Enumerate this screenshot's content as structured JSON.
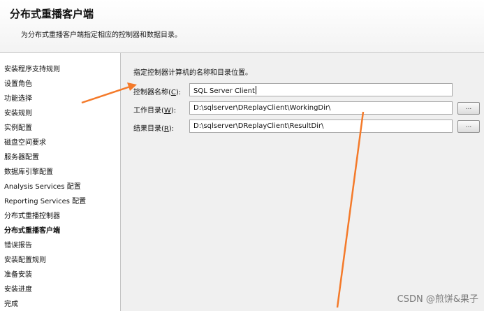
{
  "header": {
    "title": "分布式重播客户端",
    "subtitle": "为分布式重播客户端指定相应的控制器和数据目录。"
  },
  "sidebar": {
    "items": [
      {
        "label": "安装程序支持规则"
      },
      {
        "label": "设置角色"
      },
      {
        "label": "功能选择"
      },
      {
        "label": "安装规则"
      },
      {
        "label": "实例配置"
      },
      {
        "label": "磁盘空间要求"
      },
      {
        "label": "服务器配置"
      },
      {
        "label": "数据库引擎配置"
      },
      {
        "label": "Analysis Services 配置"
      },
      {
        "label": "Reporting Services 配置"
      },
      {
        "label": "分布式重播控制器"
      },
      {
        "label": "分布式重播客户端",
        "active": true
      },
      {
        "label": "错误报告"
      },
      {
        "label": "安装配置规则"
      },
      {
        "label": "准备安装"
      },
      {
        "label": "安装进度"
      },
      {
        "label": "完成"
      }
    ]
  },
  "main": {
    "instruction": "指定控制器计算机的名称和目录位置。",
    "controller": {
      "label_prefix": "控制器名称(",
      "label_key": "C",
      "label_suffix": "):",
      "value": "SQL Server Client"
    },
    "working_dir": {
      "label_prefix": "工作目录(",
      "label_key": "W",
      "label_suffix": "):",
      "value": "D:\\sqlserver\\DReplayClient\\WorkingDir\\",
      "browse_label": "..."
    },
    "result_dir": {
      "label_prefix": "结果目录(",
      "label_key": "R",
      "label_suffix": "):",
      "value": "D:\\sqlserver\\DReplayClient\\ResultDir\\",
      "browse_label": "..."
    }
  },
  "watermark": "CSDN @煎饼&果子",
  "colors": {
    "annotation_arrow": "#f47a2a",
    "sidebar_border": "#c4c4c4",
    "content_bg": "#f0f0f0"
  }
}
